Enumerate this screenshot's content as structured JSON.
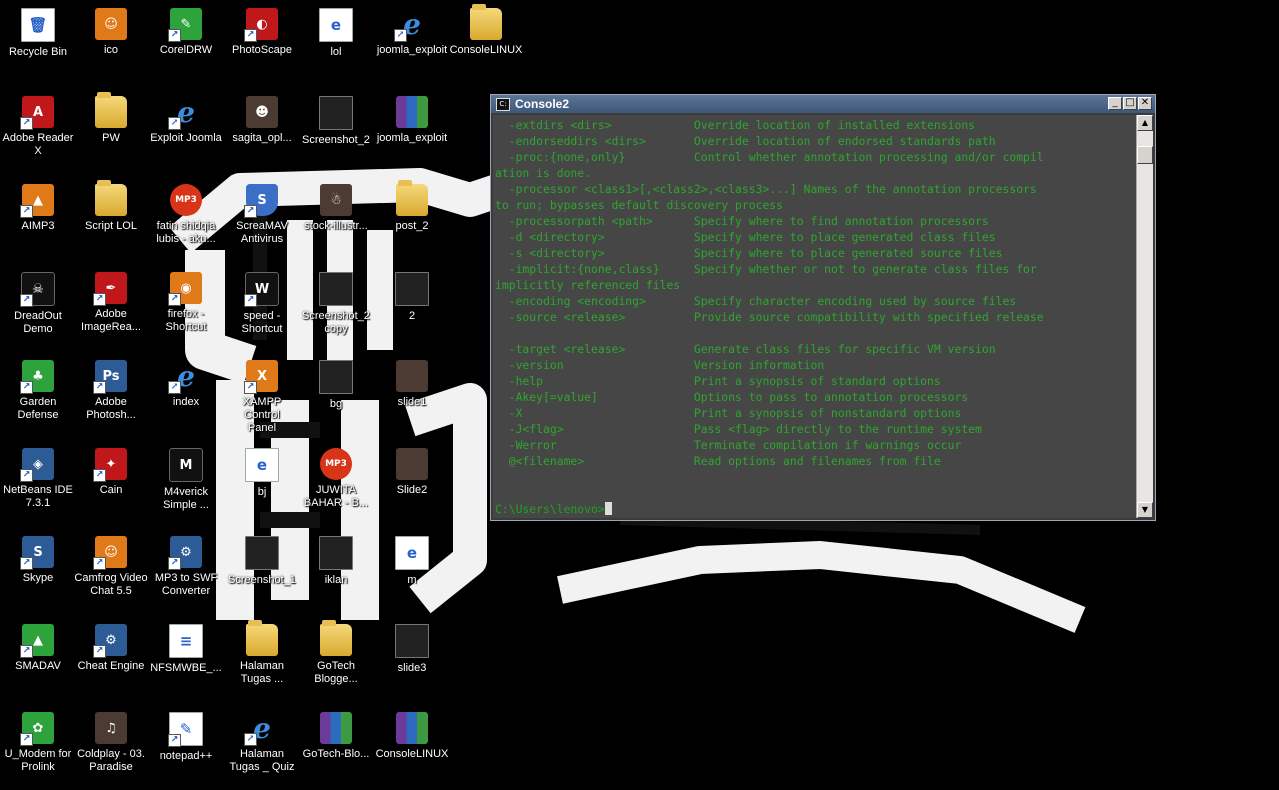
{
  "desktop": {
    "icons": [
      {
        "label": "Recycle Bin",
        "glyph": "🗑",
        "kind": "doc",
        "icon_name": "recycle-bin-icon",
        "shortcut": false
      },
      {
        "label": "ico",
        "glyph": "☺",
        "kind": "orange",
        "icon_name": "ico-icon",
        "shortcut": false
      },
      {
        "label": "CorelDRW",
        "glyph": "✎",
        "kind": "green",
        "icon_name": "coreldraw-icon",
        "shortcut": true
      },
      {
        "label": "PhotoScape",
        "glyph": "◐",
        "kind": "red",
        "icon_name": "photoscape-icon",
        "shortcut": true
      },
      {
        "label": "lol",
        "glyph": "e",
        "kind": "doc",
        "icon_name": "html-file-icon",
        "shortcut": false
      },
      {
        "label": "joomla_exploit",
        "glyph": "e",
        "kind": "ie",
        "icon_name": "ie-link-icon",
        "shortcut": true
      },
      {
        "label": "ConsoleLINUX",
        "glyph": "",
        "kind": "folder",
        "icon_name": "folder-icon",
        "shortcut": false
      },
      {
        "label": "Adobe Reader\nX",
        "glyph": "A",
        "kind": "red",
        "icon_name": "adobe-reader-icon",
        "shortcut": true
      },
      {
        "label": "PW",
        "glyph": "",
        "kind": "folder",
        "icon_name": "folder-icon",
        "shortcut": false
      },
      {
        "label": "Exploit Joomla",
        "glyph": "e",
        "kind": "ie",
        "icon_name": "ie-link-icon",
        "shortcut": true
      },
      {
        "label": "sagita_opl...",
        "glyph": "☻",
        "kind": "photo",
        "icon_name": "image-file-icon",
        "shortcut": false
      },
      {
        "label": "Screenshot_2",
        "glyph": "",
        "kind": "shot",
        "icon_name": "image-file-icon",
        "shortcut": false
      },
      {
        "label": "joomla_exploit",
        "glyph": "",
        "kind": "rar",
        "icon_name": "winrar-archive-icon",
        "shortcut": false
      },
      {
        "label": "AIMP3",
        "glyph": "▲",
        "kind": "orange",
        "icon_name": "aimp-icon",
        "shortcut": true
      },
      {
        "label": "Script LOL",
        "glyph": "",
        "kind": "folder",
        "icon_name": "folder-icon",
        "shortcut": false
      },
      {
        "label": "fatin shidqia\nlubis - aku...",
        "glyph": "MP3",
        "kind": "mp3",
        "icon_name": "mp3-file-icon",
        "shortcut": false
      },
      {
        "label": "ScreaMAV\nAntivirus",
        "glyph": "S",
        "kind": "shield",
        "icon_name": "antivirus-icon",
        "shortcut": true
      },
      {
        "label": "stock-illustr...",
        "glyph": "☃",
        "kind": "photo",
        "icon_name": "image-file-icon",
        "shortcut": false
      },
      {
        "label": "post_2",
        "glyph": "",
        "kind": "folder",
        "icon_name": "folder-icon",
        "shortcut": false
      },
      {
        "label": "DreadOut\nDemo",
        "glyph": "☠",
        "kind": "black",
        "icon_name": "dreadout-icon",
        "shortcut": true
      },
      {
        "label": "Adobe\nImageRea...",
        "glyph": "✒",
        "kind": "red",
        "icon_name": "adobe-imageready-icon",
        "shortcut": true
      },
      {
        "label": "firefox -\nShortcut",
        "glyph": "◉",
        "kind": "orange",
        "icon_name": "firefox-icon",
        "shortcut": true
      },
      {
        "label": "speed -\nShortcut",
        "glyph": "W",
        "kind": "black",
        "icon_name": "speed-game-icon",
        "shortcut": true
      },
      {
        "label": "Screenshot_2\ncopy",
        "glyph": "",
        "kind": "shot",
        "icon_name": "image-file-icon",
        "shortcut": false
      },
      {
        "label": "2",
        "glyph": "",
        "kind": "shot",
        "icon_name": "image-file-icon",
        "shortcut": false
      },
      {
        "label": "Garden\nDefense",
        "glyph": "♣",
        "kind": "green",
        "icon_name": "garden-defense-icon",
        "shortcut": true
      },
      {
        "label": "Adobe\nPhotosh...",
        "glyph": "Ps",
        "kind": "app",
        "icon_name": "photoshop-icon",
        "shortcut": true
      },
      {
        "label": "index",
        "glyph": "e",
        "kind": "ie",
        "icon_name": "ie-link-icon",
        "shortcut": true
      },
      {
        "label": "XAMPP Control\nPanel",
        "glyph": "X",
        "kind": "orange",
        "icon_name": "xampp-icon",
        "shortcut": true
      },
      {
        "label": "bg",
        "glyph": "",
        "kind": "shot",
        "icon_name": "image-file-icon",
        "shortcut": false
      },
      {
        "label": "slide1",
        "glyph": "",
        "kind": "photo",
        "icon_name": "image-file-icon",
        "shortcut": false
      },
      {
        "label": "NetBeans IDE\n7.3.1",
        "glyph": "◈",
        "kind": "app",
        "icon_name": "netbeans-icon",
        "shortcut": true
      },
      {
        "label": "Cain",
        "glyph": "✦",
        "kind": "red",
        "icon_name": "cain-icon",
        "shortcut": true
      },
      {
        "label": "M4verick\nSimple ...",
        "glyph": "M",
        "kind": "black",
        "icon_name": "m4verick-icon",
        "shortcut": false
      },
      {
        "label": "bj",
        "glyph": "e",
        "kind": "doc",
        "icon_name": "html-file-icon",
        "shortcut": false
      },
      {
        "label": "JUWITA\nBAHAR - B...",
        "glyph": "MP3",
        "kind": "mp3",
        "icon_name": "mp3-file-icon",
        "shortcut": false
      },
      {
        "label": "Slide2",
        "glyph": "",
        "kind": "photo",
        "icon_name": "image-file-icon",
        "shortcut": false
      },
      {
        "label": "Skype",
        "glyph": "S",
        "kind": "app",
        "icon_name": "skype-icon",
        "shortcut": true
      },
      {
        "label": "Camfrog Video\nChat 5.5",
        "glyph": "☺",
        "kind": "orange",
        "icon_name": "camfrog-icon",
        "shortcut": true
      },
      {
        "label": "MP3 to SWF\nConverter",
        "glyph": "⚙",
        "kind": "app",
        "icon_name": "mp3-to-swf-icon",
        "shortcut": true
      },
      {
        "label": "Screenshot_1",
        "glyph": "",
        "kind": "shot",
        "icon_name": "image-file-icon",
        "shortcut": false
      },
      {
        "label": "iklan",
        "glyph": "",
        "kind": "shot",
        "icon_name": "image-file-icon",
        "shortcut": false
      },
      {
        "label": "m",
        "glyph": "e",
        "kind": "doc",
        "icon_name": "html-file-icon",
        "shortcut": false
      },
      {
        "label": "SMADAV",
        "glyph": "▲",
        "kind": "green",
        "icon_name": "smadav-icon",
        "shortcut": true
      },
      {
        "label": "Cheat Engine",
        "glyph": "⚙",
        "kind": "app",
        "icon_name": "cheat-engine-icon",
        "shortcut": true
      },
      {
        "label": "NFSMWBE_...",
        "glyph": "≡",
        "kind": "doc",
        "icon_name": "document-icon",
        "shortcut": false
      },
      {
        "label": "Halaman\nTugas ...",
        "glyph": "",
        "kind": "folder",
        "icon_name": "folder-icon",
        "shortcut": false
      },
      {
        "label": "GoTech\nBlogge...",
        "glyph": "",
        "kind": "folder",
        "icon_name": "folder-icon",
        "shortcut": false
      },
      {
        "label": "slide3",
        "glyph": "",
        "kind": "shot",
        "icon_name": "image-file-icon",
        "shortcut": false
      },
      {
        "label": "U_Modem for\nProlink",
        "glyph": "✿",
        "kind": "green",
        "icon_name": "umodem-icon",
        "shortcut": true
      },
      {
        "label": "Coldplay - 03.\nParadise",
        "glyph": "♫",
        "kind": "photo",
        "icon_name": "music-file-icon",
        "shortcut": false
      },
      {
        "label": "notepad++",
        "glyph": "✎",
        "kind": "doc",
        "icon_name": "notepad-plus-icon",
        "shortcut": true
      },
      {
        "label": "Halaman\nTugas _ Quiz",
        "glyph": "e",
        "kind": "ie",
        "icon_name": "ie-link-icon",
        "shortcut": true
      },
      {
        "label": "GoTech-Blo...",
        "glyph": "",
        "kind": "rar",
        "icon_name": "winrar-archive-icon",
        "shortcut": false
      },
      {
        "label": "ConsoleLINUX",
        "glyph": "",
        "kind": "rar",
        "icon_name": "winrar-archive-icon",
        "shortcut": false
      }
    ]
  },
  "console": {
    "title": "Console2",
    "buttons": {
      "minimize": "_",
      "maximize": "□",
      "close": "✕"
    },
    "lines": [
      "  -extdirs <dirs>            Override location of installed extensions",
      "  -endorseddirs <dirs>       Override location of endorsed standards path",
      "  -proc:{none,only}          Control whether annotation processing and/or compil",
      "ation is done.",
      "  -processor <class1>[,<class2>,<class3>...] Names of the annotation processors",
      "to run; bypasses default discovery process",
      "  -processorpath <path>      Specify where to find annotation processors",
      "  -d <directory>             Specify where to place generated class files",
      "  -s <directory>             Specify where to place generated source files",
      "  -implicit:{none,class}     Specify whether or not to generate class files for",
      "implicitly referenced files",
      "  -encoding <encoding>       Specify character encoding used by source files",
      "  -source <release>          Provide source compatibility with specified release",
      "",
      "  -target <release>          Generate class files for specific VM version",
      "  -version                   Version information",
      "  -help                      Print a synopsis of standard options",
      "  -Akey[=value]              Options to pass to annotation processors",
      "  -X                         Print a synopsis of nonstandard options",
      "  -J<flag>                   Pass <flag> directly to the runtime system",
      "  -Werror                    Terminate compilation if warnings occur",
      "  @<filename>                Read options and filenames from file",
      "",
      ""
    ],
    "prompt": "C:\\Users\\lenovo>"
  }
}
